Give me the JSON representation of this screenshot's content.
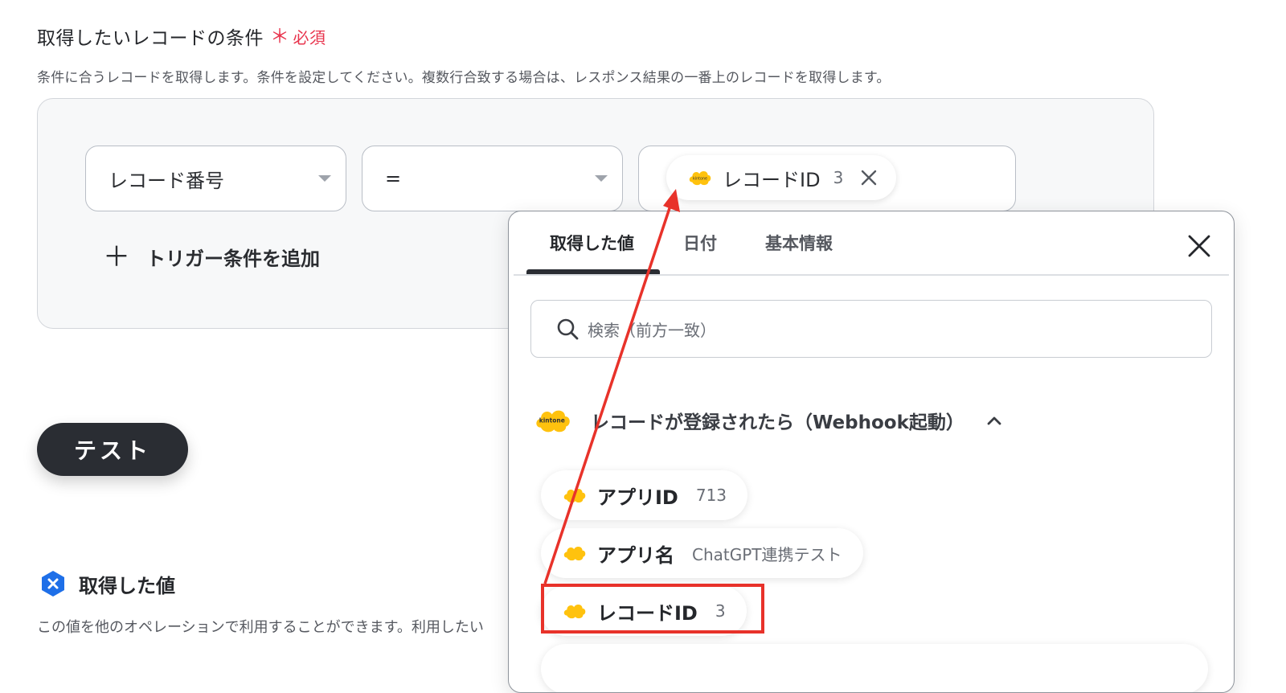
{
  "condition": {
    "title": "取得したいレコードの条件",
    "required_mark": "＊",
    "required_text": "必須",
    "description": "条件に合うレコードを取得します。条件を設定してください。複数行合致する場合は、レスポンス結果の一番上のレコードを取得します。",
    "field_select": "レコード番号",
    "operator_select": "=",
    "value_chip": {
      "label": "レコードID",
      "value": "3",
      "icon": "kintone-logo"
    },
    "add_trigger_label": "トリガー条件を追加"
  },
  "test_button": "テスト",
  "output": {
    "title": "取得した値",
    "description": "この値を他のオペレーションで利用することができます。利用したい"
  },
  "popup": {
    "tabs": [
      "取得した値",
      "日付",
      "基本情報"
    ],
    "active_tab": "取得した値",
    "search_placeholder": "検索（前方一致）",
    "group_title": "レコードが登録されたら（Webhook起動）",
    "items": [
      {
        "label": "アプリID",
        "value": "713"
      },
      {
        "label": "アプリ名",
        "value": "ChatGPT連携テスト"
      },
      {
        "label": "レコードID",
        "value": "3"
      }
    ],
    "kintone_logo_text": "kintone"
  },
  "colors": {
    "accent_red": "#e8344d",
    "annotation_red": "#e8322a",
    "kintone_yellow": "#ffc20e",
    "dark_button": "#2a2d33",
    "yoom_blue": "#1e6fe8"
  }
}
